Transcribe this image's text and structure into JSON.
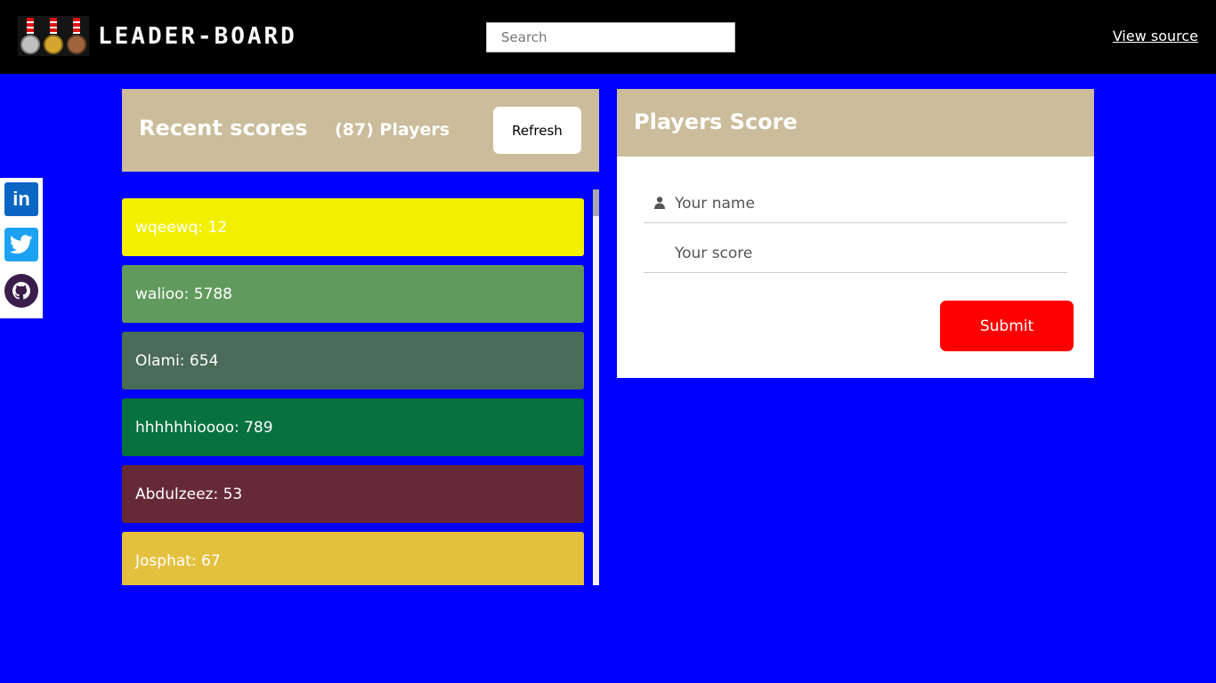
{
  "header": {
    "title": "LEADER-BOARD",
    "search_placeholder": "Search",
    "view_source_label": "View source",
    "medal_colors": [
      "#c0c0c0",
      "#d4a72c",
      "#a0643c"
    ]
  },
  "social": {
    "linkedin_label": "in",
    "items": [
      "linkedin-icon",
      "twitter-icon",
      "github-icon"
    ]
  },
  "recent": {
    "title": "Recent scores",
    "player_count": "(87) Players",
    "refresh_label": "Refresh",
    "scores": [
      {
        "text": "wqeewq: 12",
        "color": "#f2f000"
      },
      {
        "text": "walioo: 5788",
        "color": "#619a5d"
      },
      {
        "text": "Olami: 654",
        "color": "#4b6b59"
      },
      {
        "text": "hhhhhhioooo: 789",
        "color": "#07713f"
      },
      {
        "text": "Abdulzeez: 53",
        "color": "#662a37"
      },
      {
        "text": "Josphat: 67",
        "color": "#e3c13f"
      }
    ]
  },
  "form": {
    "title": "Players Score",
    "name_placeholder": "Your name",
    "score_placeholder": "Your score",
    "submit_label": "Submit"
  },
  "colors": {
    "page_bg": "#0000ff",
    "panel_header": "#cbbc9b",
    "submit": "#ff0000"
  }
}
